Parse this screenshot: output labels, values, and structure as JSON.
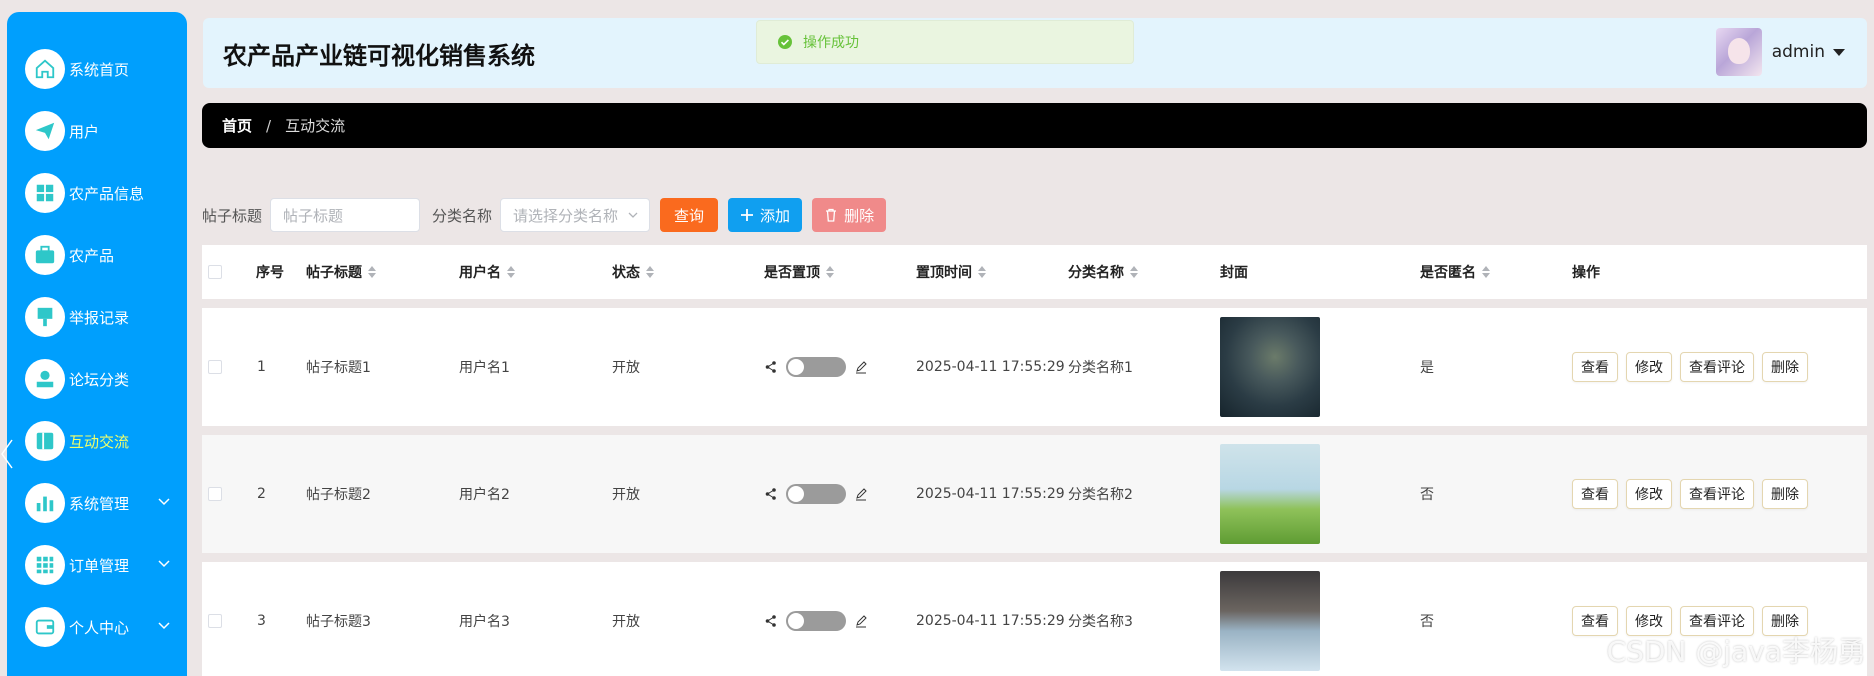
{
  "app": {
    "title": "农产品产业链可视化销售系统"
  },
  "user": {
    "name": "admin"
  },
  "toast": {
    "message": "操作成功",
    "color": "#67c23a"
  },
  "sidebar": {
    "items": [
      {
        "label": "系统首页",
        "icon": "home-icon"
      },
      {
        "label": "用户",
        "icon": "paper-plane-icon"
      },
      {
        "label": "农产品信息",
        "icon": "grid-icon"
      },
      {
        "label": "农产品",
        "icon": "briefcase-icon"
      },
      {
        "label": "举报记录",
        "icon": "brush-icon"
      },
      {
        "label": "论坛分类",
        "icon": "stamp-icon"
      },
      {
        "label": "互动交流",
        "icon": "book-icon",
        "active": true
      },
      {
        "label": "系统管理",
        "icon": "bar-chart-icon",
        "expandable": true
      },
      {
        "label": "订单管理",
        "icon": "apps-icon",
        "expandable": true
      },
      {
        "label": "个人中心",
        "icon": "wallet-icon",
        "expandable": true
      }
    ]
  },
  "breadcrumb": {
    "home": "首页",
    "separator": "/",
    "current": "互动交流"
  },
  "search": {
    "title_label": "帖子标题",
    "title_placeholder": "帖子标题",
    "category_label": "分类名称",
    "category_placeholder": "请选择分类名称",
    "query_button": "查询",
    "add_button": "添加",
    "delete_button": "删除"
  },
  "table": {
    "columns": [
      "序号",
      "帖子标题",
      "用户名",
      "状态",
      "是否置顶",
      "置顶时间",
      "分类名称",
      "封面",
      "是否匿名",
      "操作"
    ],
    "rows": [
      {
        "index": "1",
        "title": "帖子标题1",
        "user": "用户名1",
        "status": "开放",
        "pinned": false,
        "pin_time": "2025-04-11 17:55:29",
        "category": "分类名称1",
        "anonymous": "是"
      },
      {
        "index": "2",
        "title": "帖子标题2",
        "user": "用户名2",
        "status": "开放",
        "pinned": false,
        "pin_time": "2025-04-11 17:55:29",
        "category": "分类名称2",
        "anonymous": "否"
      },
      {
        "index": "3",
        "title": "帖子标题3",
        "user": "用户名3",
        "status": "开放",
        "pinned": false,
        "pin_time": "2025-04-11 17:55:29",
        "category": "分类名称3",
        "anonymous": "否"
      }
    ],
    "actions": {
      "view": "查看",
      "edit": "修改",
      "comments": "查看评论",
      "delete": "删除"
    }
  },
  "watermark": "CSDN @java李杨勇",
  "colors": {
    "sidebar": "#009ffd",
    "header": "#e3f4fd",
    "query": "#fa6a1e",
    "add": "#109ff0",
    "delete": "#f08a8a"
  }
}
